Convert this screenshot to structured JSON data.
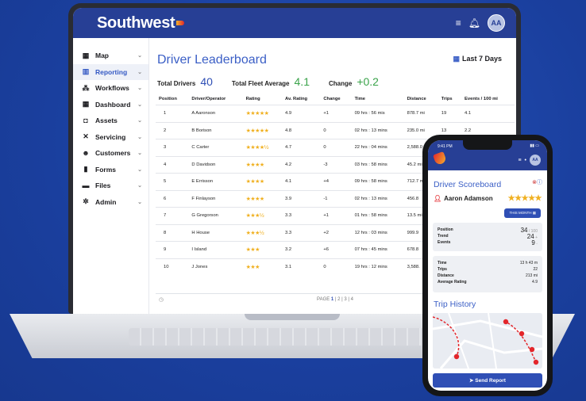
{
  "brand": "Southwest",
  "topbar": {
    "avatar_initials": "AA"
  },
  "sidebar": {
    "items": [
      {
        "label": "Map",
        "icon": "map-icon"
      },
      {
        "label": "Reporting",
        "icon": "bar-chart-icon",
        "active": true
      },
      {
        "label": "Workflows",
        "icon": "workflow-icon"
      },
      {
        "label": "Dashboard",
        "icon": "grid-icon"
      },
      {
        "label": "Assets",
        "icon": "car-icon"
      },
      {
        "label": "Servicing",
        "icon": "wrench-icon"
      },
      {
        "label": "Customers",
        "icon": "users-icon"
      },
      {
        "label": "Forms",
        "icon": "clipboard-icon"
      },
      {
        "label": "Files",
        "icon": "folder-icon"
      },
      {
        "label": "Admin",
        "icon": "gear-icon"
      }
    ]
  },
  "main": {
    "title": "Driver Leaderboard",
    "date_range": "Last 7 Days",
    "stats": {
      "total_drivers_label": "Total Drivers",
      "total_drivers": "40",
      "fleet_avg_label": "Total Fleet Average",
      "fleet_avg": "4.1",
      "change_label": "Change",
      "change": "+0.2"
    },
    "table": {
      "headers": [
        "Position",
        "Driver/Operator",
        "Rating",
        "Av. Rating",
        "Change",
        "Time",
        "Distance",
        "Trips",
        "Events / 100 mi"
      ],
      "rows": [
        [
          "1",
          "A Aaronson",
          "★★★★★",
          "4.9",
          "+1",
          "09 hrs : 56 mis",
          "878.7 mi",
          "19",
          "4.1"
        ],
        [
          "2",
          "B Borison",
          "★★★★★",
          "4.8",
          "0",
          "02 hrs : 13 mins",
          "235.0 mi",
          "13",
          "2.2"
        ],
        [
          "3",
          "C Carter",
          "★★★★½",
          "4.7",
          "0",
          "22 hrs : 04 mins",
          "2,588.0",
          "",
          ""
        ],
        [
          "4",
          "D Davidson",
          "★★★★",
          "4.2",
          "-3",
          "03 hrs : 58 mins",
          "45.2 mi",
          "",
          ""
        ],
        [
          "5",
          "E Errisson",
          "★★★★",
          "4.1",
          "+4",
          "09 hrs : 58 mins",
          "712.7 mi",
          "",
          ""
        ],
        [
          "6",
          "F Finlayson",
          "★★★★",
          "3.9",
          "-1",
          "02 hrs : 13 mins",
          "456.8",
          "",
          ""
        ],
        [
          "7",
          "G Gregorson",
          "★★★½",
          "3.3",
          "+1",
          "01 hrs : 58 mins",
          "13.5 mi",
          "",
          ""
        ],
        [
          "8",
          "H House",
          "★★★½",
          "3.3",
          "+2",
          "12 hrs : 03 mins",
          "999.9",
          "",
          ""
        ],
        [
          "9",
          "I Island",
          "★★★",
          "3.2",
          "+6",
          "07 hrs : 45 mins",
          "678.8",
          "",
          ""
        ],
        [
          "10",
          "J Jones",
          "★★★",
          "3.1",
          "0",
          "19 hrs : 12 mins",
          "3,588.",
          "",
          ""
        ]
      ]
    },
    "pager": {
      "label": "PAGE",
      "current": "1",
      "rest": "| 2 | 3 | 4"
    }
  },
  "phone": {
    "time": "9:41 PM",
    "avatar_initials": "AA",
    "title": "Driver Scoreboard",
    "driver": "Aaron Adamson",
    "stars": "★★★★★",
    "period_button": "THIS MONTH",
    "card1": [
      {
        "label": "Position",
        "value": "34",
        "unit": "/ 100"
      },
      {
        "label": "Trend",
        "value": "24",
        "unit": "+"
      },
      {
        "label": "Events",
        "value": "9",
        "unit": "◦"
      }
    ],
    "card2": [
      {
        "label": "Time",
        "value": "13 h 43 m"
      },
      {
        "label": "Trips",
        "value": "22"
      },
      {
        "label": "Distance",
        "value": "213 mi"
      },
      {
        "label": "Average Rating",
        "value": "4.9"
      }
    ],
    "trip_history": "Trip History",
    "send_button": "Send Report"
  },
  "colors": {
    "brand_blue": "#273f95",
    "accent_blue": "#3b5fc6",
    "star": "#f0b020",
    "positive": "#3aa34a",
    "background": "#1a3f9e"
  }
}
